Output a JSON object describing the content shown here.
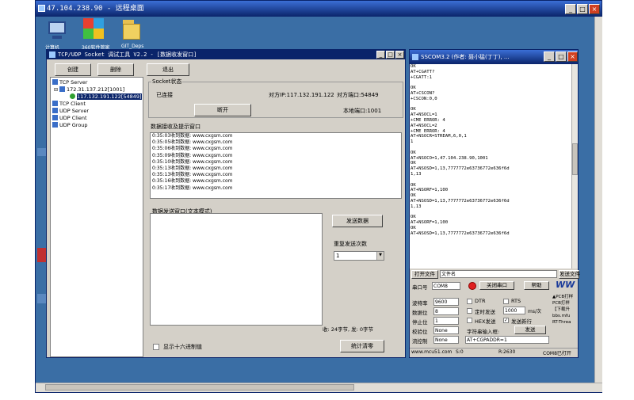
{
  "remote": {
    "title": "47.104.238.90 - 远程桌面",
    "min": "_",
    "max": "□",
    "close": "×"
  },
  "desktop": {
    "icons": [
      {
        "label": "计算机"
      },
      {
        "label": "360软件管家"
      },
      {
        "label": "GIT_Deps"
      }
    ]
  },
  "sock": {
    "title": "TCP/UDP Socket 调试工具 V2.2 - [数据收发窗口]",
    "btn_create": "创建",
    "btn_delete": "删除",
    "btn_exit": "退出",
    "tree": {
      "tcp_server": "TCP Server",
      "server_ip": "172.31.137.212[1001]",
      "client_ip": "117.132.191.122[54849]",
      "tcp_client": "TCP Client",
      "udp_server": "UDP Server",
      "udp_client": "UDP Client",
      "udp_group": "UDP Group"
    },
    "socket_state_label": "Socket状态",
    "connected": "已连接",
    "peer_ip": "对方IP:117.132.191.122",
    "peer_port": "对方端口:54849",
    "disconnect": "断开",
    "local_port": "本地端口:1001",
    "recv_label": "数据接收及提示窗口",
    "recv_lines": [
      "0:35:03收到数据: www.cxgsm.com",
      "0:35:05收到数据: www.cxgsm.com",
      "0:35:06收到数据: www.cxgsm.com",
      "0:35:09收到数据: www.cxgsm.com",
      "0:35:10收到数据: www.cxgsm.com",
      "0:35:13收到数据: www.cxgsm.com",
      "0:35:13收到数据: www.cxgsm.com",
      "0:35:16收到数据: www.cxgsm.com",
      "0:35:17收到数据: www.cxgsm.com"
    ],
    "send_label": "数据发送窗口(文本模式)",
    "send_button": "发送数据",
    "repeat_label": "重复发送次数",
    "repeat_value": "1",
    "counter": "收: 24字节, 发: 0字节",
    "hex_label": "显示十六进制值",
    "clear_stats": "统计清零"
  },
  "sscom": {
    "title": "SSCOM3.2 (作者: 聂小猛(丁丁), ...",
    "lines": [
      "OK",
      "AT+CGATT?",
      "+CGATT:1",
      "",
      "OK",
      "AT+CSCON?",
      "+CSCON:0,0",
      "",
      "OK",
      "AT+NSOCL=1",
      "+CME ERROR: 4",
      "AT+NSOCL=2",
      "+CME ERROR: 4",
      "AT+NSOCR=STREAM,6,0,1",
      "1",
      "",
      "OK",
      "AT+NSOCO=1,47.104.238.90,1001",
      "OK",
      "AT+NSOSD=1,13,7777772e63736772e636f6d",
      "1,13",
      "",
      "OK",
      "AT+NSORF=1,100",
      "OK",
      "AT+NSOSD=1,13,7777772e63736772e636f6d",
      "1,13",
      "",
      "OK",
      "AT+NSORF=1,100",
      "OK",
      "AT+NSOSD=1,13,7777772e63736772e636f6d"
    ],
    "open_file": "打开文件",
    "filename": "文件名",
    "send_file": "发送文件",
    "port_label": "串口号",
    "port_value": "COM8",
    "close_port": "关闭串口",
    "help": "帮助",
    "logo": "WW",
    "baud_label": "波特率",
    "baud_value": "9600",
    "data_label": "数据位",
    "data_value": "8",
    "stop_label": "停止位",
    "stop_value": "1",
    "parity_label": "校验位",
    "parity_value": "None",
    "flow_label": "流控制",
    "flow_value": "None",
    "dtr": "DTR",
    "rts": "RTS",
    "timed_send": "定时发送",
    "interval_value": "1000",
    "interval_unit": "ms/次",
    "hex_send": "HEX发送",
    "send_newline": "发送新行",
    "char_input": "字符串输入框:",
    "send": "发送",
    "input_value": "AT+CGPADDR=1",
    "ad_lines": [
      "▲PCB打样",
      "PCB打样",
      "【下载升",
      "bbs.mfu",
      "RT-Threa"
    ],
    "status_site": "www.mcu51.com",
    "status_s": "S:0",
    "status_r": "R:2630",
    "status_port": "COM8已打开"
  }
}
